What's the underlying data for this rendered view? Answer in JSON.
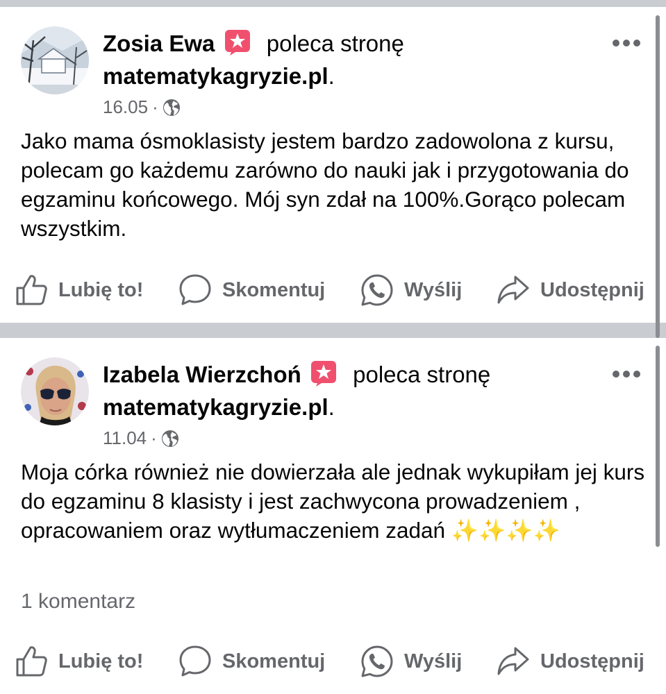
{
  "posts": [
    {
      "author": "Zosia Ewa",
      "action": "poleca stronę",
      "page": "matematykagryzie.pl",
      "date": "16.05",
      "text": "Jako mama ósmoklasisty jestem bardzo zadowolona z kursu, polecam go każdemu  zarówno do nauki jak i przygotowania do egzaminu końcowego. Mój syn zdał na 100%.Gorąco polecam wszystkim.",
      "comments": ""
    },
    {
      "author": "Izabela Wierzchoń",
      "action": "poleca stronę",
      "page": "matematykagryzie.pl",
      "date": "11.04",
      "text": "Moja córka również nie dowierzała ale jednak wykupiłam jej kurs do egzaminu 8 klasisty i jest zachwycona prowadzeniem , opracowaniem oraz wytłumaczeniem zadań ✨✨✨✨",
      "comments": "1 komentarz"
    }
  ],
  "actions": {
    "like": "Lubię to!",
    "comment": "Skomentuj",
    "send": "Wyślij",
    "share": "Udostępnij"
  },
  "icons": {
    "badge": "recommendation-star-icon",
    "privacy": "globe-icon",
    "more": "more-options-icon",
    "like": "thumbs-up-icon",
    "comment": "comment-bubble-icon",
    "send": "whatsapp-icon",
    "share": "share-arrow-icon"
  },
  "colors": {
    "badge": "#f0506e",
    "divider": "#c9ccd1",
    "secondary_text": "#65676b",
    "primary_text": "#050505"
  }
}
